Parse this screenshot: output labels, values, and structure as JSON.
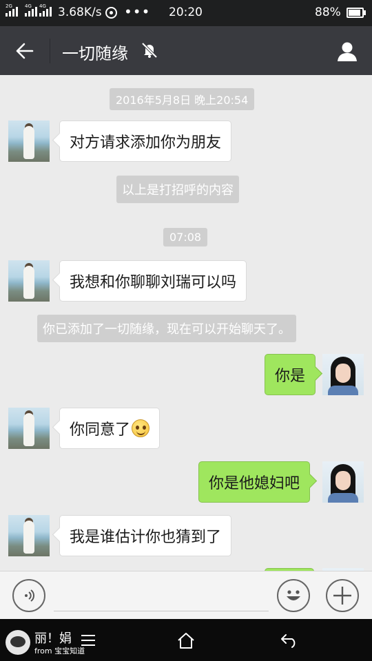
{
  "status": {
    "net1": "2G",
    "net2": "4G",
    "net3": "4G",
    "speed": "3.68K/s",
    "dots": "•••",
    "time": "20:20",
    "battery": "88%"
  },
  "header": {
    "title": "一切随缘",
    "back_icon": "arrow-left-icon",
    "mute_icon": "bell-muted-icon",
    "profile_icon": "person-icon"
  },
  "messages": [
    {
      "kind": "time",
      "text": "2016年5月8日 晚上20:54"
    },
    {
      "kind": "in",
      "text": "对方请求添加你为朋友"
    },
    {
      "kind": "system",
      "text": "以上是打招呼的内容"
    },
    {
      "kind": "time",
      "text": "07:08"
    },
    {
      "kind": "in",
      "text": "我想和你聊聊刘瑞可以吗"
    },
    {
      "kind": "system",
      "text": "你已添加了一切随缘，现在可以开始聊天了。"
    },
    {
      "kind": "out",
      "text": "你是"
    },
    {
      "kind": "in",
      "text": "你同意了",
      "emoji": "smile-emoji"
    },
    {
      "kind": "out",
      "text": "你是他媳妇吧"
    },
    {
      "kind": "in",
      "text": "我是谁估计你也猜到了"
    }
  ],
  "input": {
    "voice_icon": "voice-icon",
    "emoji_icon": "smiley-icon",
    "add_icon": "plus-icon"
  },
  "nav": {
    "brand_title": "丽！娟",
    "brand_sub": "from 宝宝知道",
    "home_icon": "home-icon",
    "back_icon": "return-icon"
  },
  "colors": {
    "titlebar": "#393a3f",
    "chat_bg": "#ebebeb",
    "bubble_out": "#9fe65e",
    "bubble_in": "#ffffff"
  }
}
